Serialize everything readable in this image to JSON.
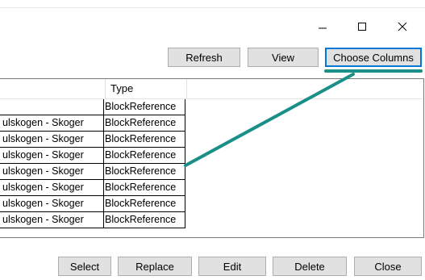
{
  "window": {
    "minimize_icon": "minimize-icon",
    "maximize_icon": "maximize-icon",
    "close_icon": "close-icon"
  },
  "toolbar": {
    "refresh_label": "Refresh",
    "view_label": "View",
    "choose_columns_label": "Choose Columns"
  },
  "grid": {
    "columns": [
      "",
      "Type"
    ],
    "rows": [
      {
        "name": "",
        "type": "BlockReference"
      },
      {
        "name": "ulskogen - Skoger",
        "type": "BlockReference"
      },
      {
        "name": "ulskogen - Skoger",
        "type": "BlockReference"
      },
      {
        "name": "ulskogen - Skoger",
        "type": "BlockReference"
      },
      {
        "name": "ulskogen - Skoger",
        "type": "BlockReference"
      },
      {
        "name": "ulskogen - Skoger",
        "type": "BlockReference"
      },
      {
        "name": "ulskogen - Skoger",
        "type": "BlockReference"
      },
      {
        "name": "ulskogen - Skoger",
        "type": "BlockReference"
      }
    ]
  },
  "footer": {
    "select_label": "Select",
    "replace_label": "Replace",
    "edit_label": "Edit",
    "delete_label": "Delete",
    "close_label": "Close"
  },
  "annotation": {
    "color": "#1a8f87"
  }
}
